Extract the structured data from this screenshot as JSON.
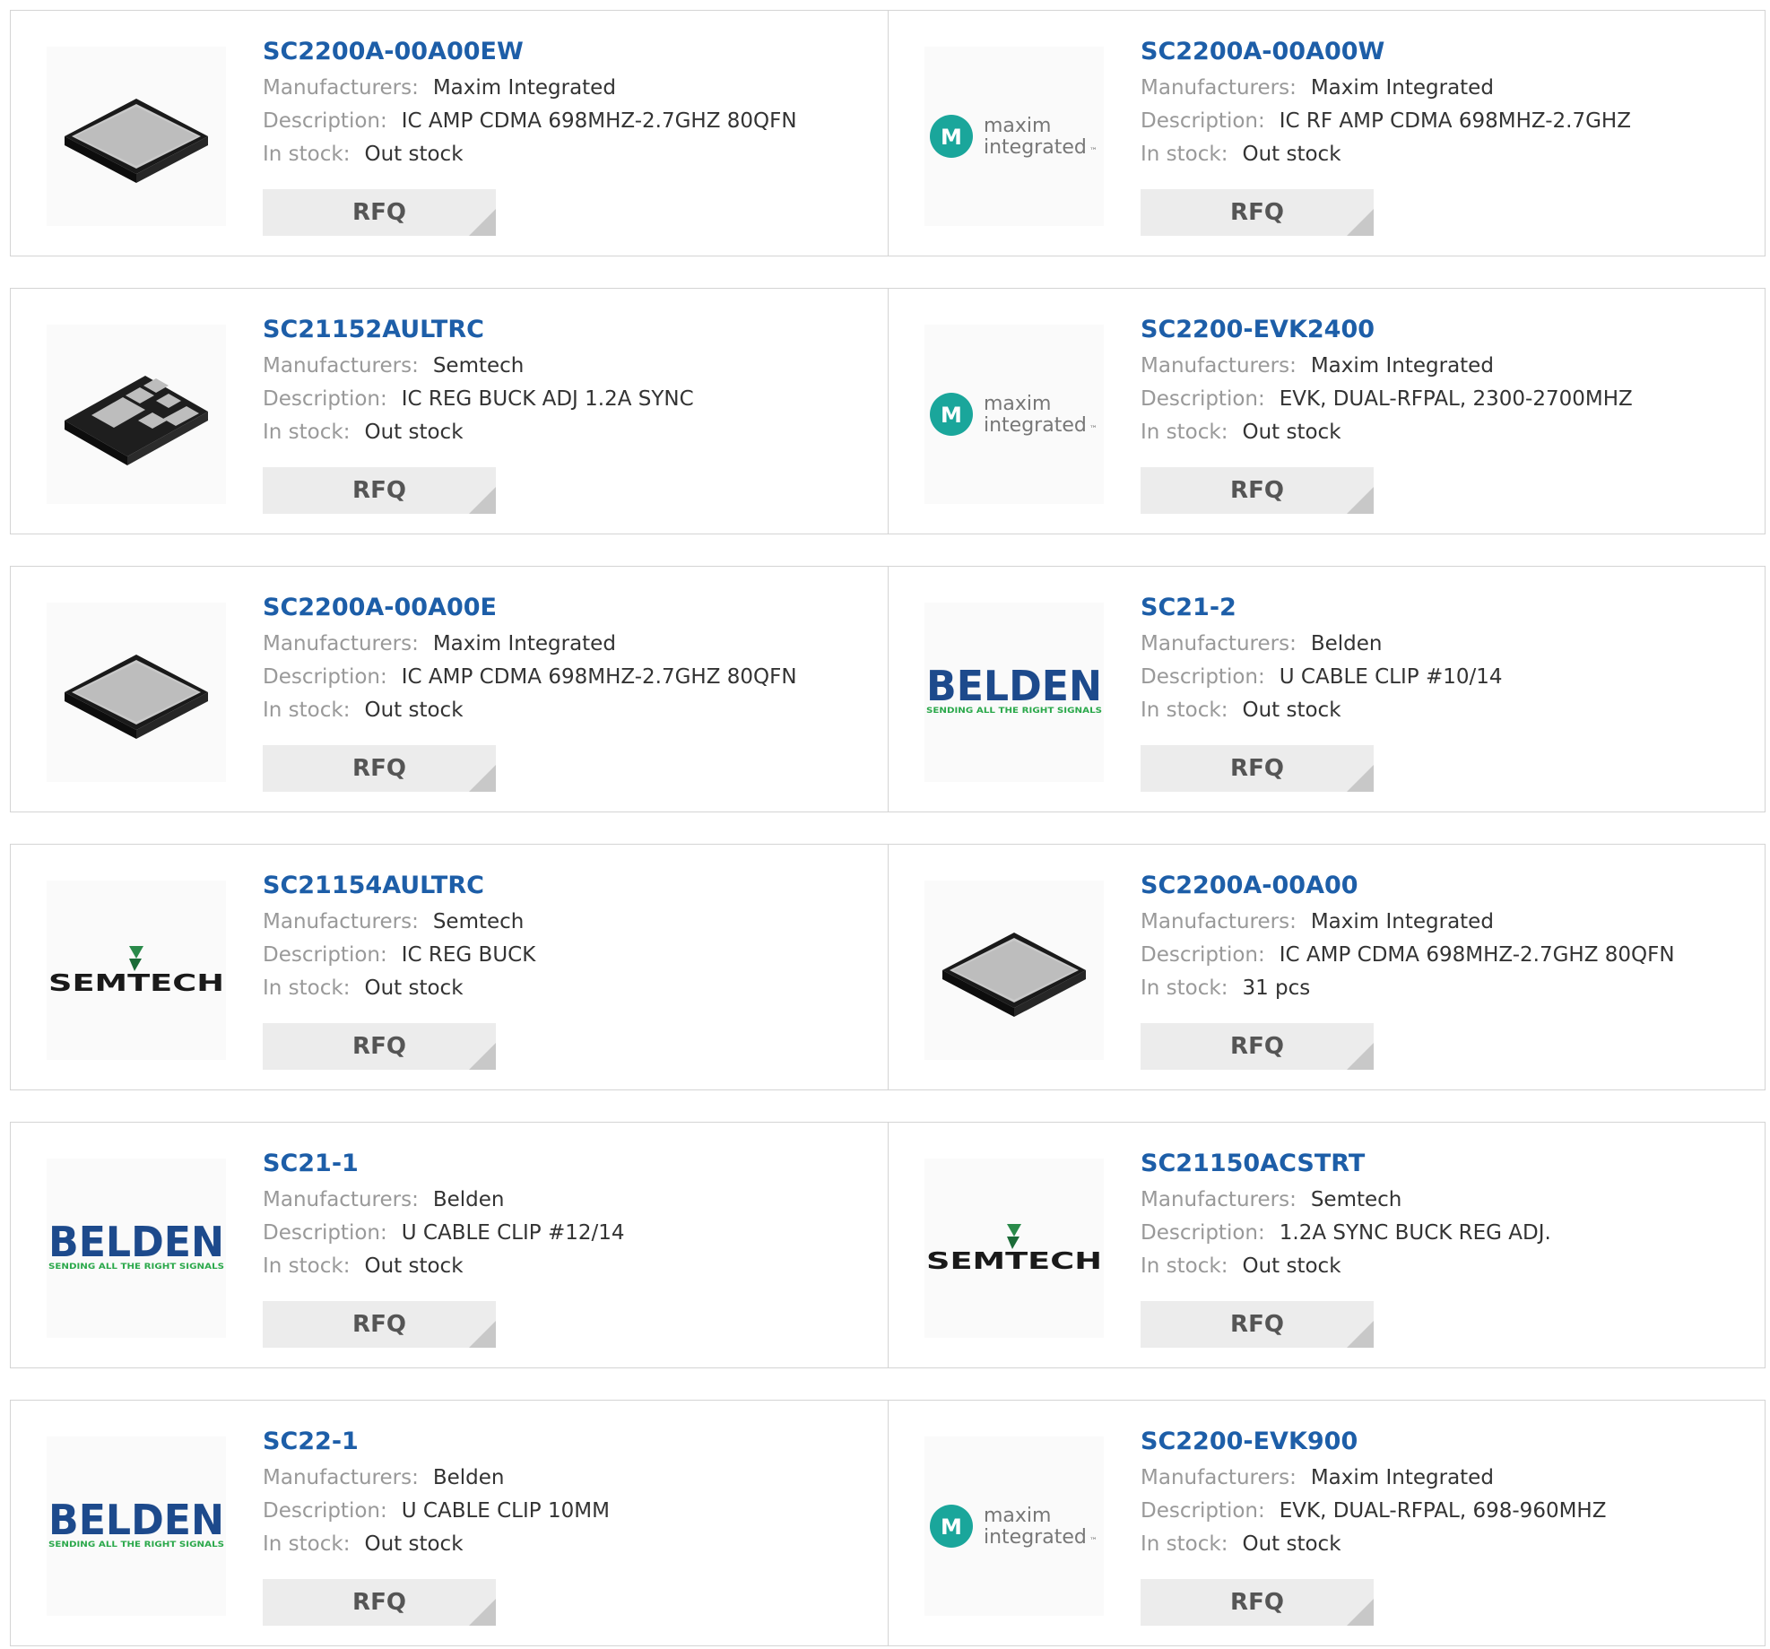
{
  "labels": {
    "manufacturers": "Manufacturers:",
    "description": "Description:",
    "stock": "In stock:",
    "rfq": "RFQ"
  },
  "colors": {
    "link": "#1d5ea8",
    "button_bg": "#ececec",
    "border": "#d4d4d4"
  },
  "products": [
    {
      "part": "SC2200A-00A00EW",
      "manufacturer": "Maxim Integrated",
      "description": "IC AMP CDMA 698MHZ-2.7GHZ 80QFN",
      "stock": "Out stock",
      "image": "qfn-chip"
    },
    {
      "part": "SC2200A-00A00W",
      "manufacturer": "Maxim Integrated",
      "description": "IC RF AMP CDMA 698MHZ-2.7GHZ",
      "stock": "Out stock",
      "image": "maxim-logo"
    },
    {
      "part": "SC21152AULTRC",
      "manufacturer": "Semtech",
      "description": "IC REG BUCK ADJ 1.2A SYNC",
      "stock": "Out stock",
      "image": "dfn-chip"
    },
    {
      "part": "SC2200-EVK2400",
      "manufacturer": "Maxim Integrated",
      "description": "EVK, DUAL-RFPAL, 2300-2700MHZ",
      "stock": "Out stock",
      "image": "maxim-logo"
    },
    {
      "part": "SC2200A-00A00E",
      "manufacturer": "Maxim Integrated",
      "description": "IC AMP CDMA 698MHZ-2.7GHZ 80QFN",
      "stock": "Out stock",
      "image": "qfn-chip"
    },
    {
      "part": "SC21-2",
      "manufacturer": "Belden",
      "description": "U CABLE CLIP #10/14",
      "stock": "Out stock",
      "image": "belden-logo"
    },
    {
      "part": "SC21154AULTRC",
      "manufacturer": "Semtech",
      "description": "IC REG BUCK",
      "stock": "Out stock",
      "image": "semtech-logo"
    },
    {
      "part": "SC2200A-00A00",
      "manufacturer": "Maxim Integrated",
      "description": "IC AMP CDMA 698MHZ-2.7GHZ 80QFN",
      "stock": "31 pcs",
      "image": "qfn-chip"
    },
    {
      "part": "SC21-1",
      "manufacturer": "Belden",
      "description": "U CABLE CLIP #12/14",
      "stock": "Out stock",
      "image": "belden-logo"
    },
    {
      "part": "SC21150ACSTRT",
      "manufacturer": "Semtech",
      "description": "1.2A SYNC BUCK REG ADJ.",
      "stock": "Out stock",
      "image": "semtech-logo"
    },
    {
      "part": "SC22-1",
      "manufacturer": "Belden",
      "description": "U CABLE CLIP 10MM",
      "stock": "Out stock",
      "image": "belden-logo"
    },
    {
      "part": "SC2200-EVK900",
      "manufacturer": "Maxim Integrated",
      "description": "EVK, DUAL-RFPAL, 698-960MHZ",
      "stock": "Out stock",
      "image": "maxim-logo"
    }
  ],
  "logos": {
    "maxim": [
      "maxim",
      "integrated",
      "™"
    ],
    "belden": [
      "BELDEN",
      "SENDING ALL THE RIGHT SIGNALS"
    ],
    "semtech": [
      "SEMTECH"
    ]
  }
}
